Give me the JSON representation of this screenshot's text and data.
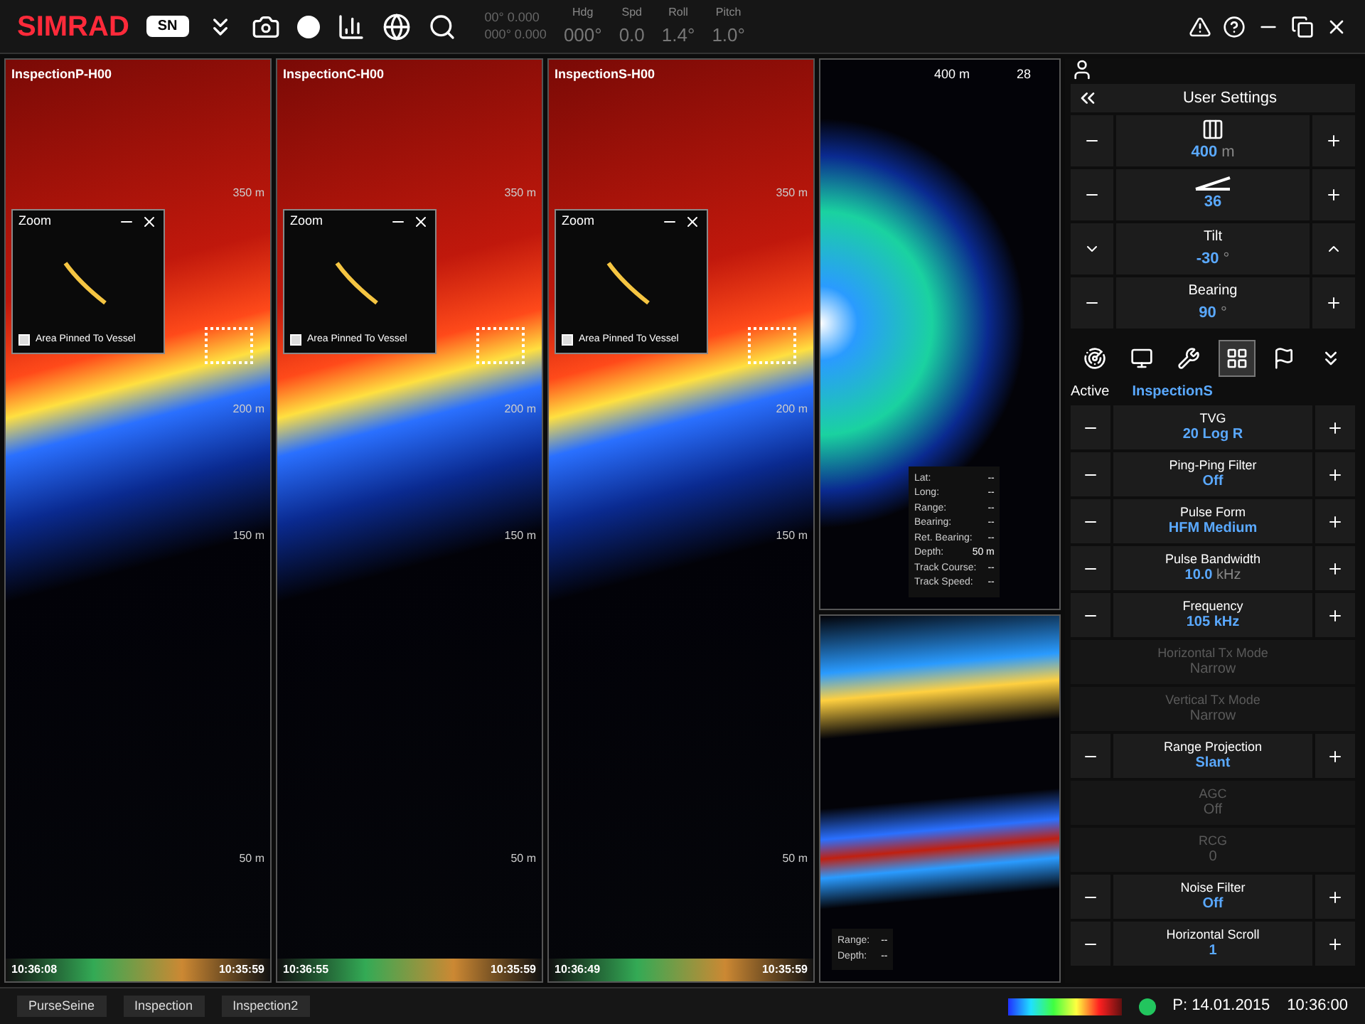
{
  "toolbar": {
    "logo": "SIMRAD",
    "model": "SN",
    "position": [
      "00° 0.000",
      "000° 0.000"
    ],
    "readouts": [
      {
        "label": "Hdg",
        "value": "000",
        "unit": "°"
      },
      {
        "label": "Spd",
        "value": "0.0"
      },
      {
        "label": "Roll",
        "value": "1.4",
        "unit": "°"
      },
      {
        "label": "Pitch",
        "value": "1.0",
        "unit": "°"
      }
    ]
  },
  "echograms": [
    {
      "title": "InspectionP-H00",
      "depth_labels": [
        "350 m",
        "200 m",
        "150 m",
        "50 m"
      ],
      "zoom": {
        "title": "Zoom",
        "pinned_label": "Area Pinned To Vessel",
        "checked": false
      },
      "time_left": "10:36:08",
      "time_right": "10:35:59"
    },
    {
      "title": "InspectionC-H00",
      "depth_labels": [
        "350 m",
        "200 m",
        "150 m",
        "50 m"
      ],
      "zoom": {
        "title": "Zoom",
        "pinned_label": "Area Pinned To Vessel",
        "checked": false
      },
      "time_left": "10:36:55",
      "time_right": "10:35:59"
    },
    {
      "title": "InspectionS-H00",
      "depth_labels": [
        "350 m",
        "200 m",
        "150 m",
        "50 m"
      ],
      "zoom": {
        "title": "Zoom",
        "pinned_label": "Area Pinned To Vessel",
        "checked": false
      },
      "time_left": "10:36:49",
      "time_right": "10:35:59"
    }
  ],
  "sonar": {
    "range": "400 m",
    "bearing_mark": "28",
    "info": [
      {
        "label": "Lat:",
        "value": "--"
      },
      {
        "label": "Long:",
        "value": "--"
      },
      {
        "label": "Range:",
        "value": "--"
      },
      {
        "label": "Bearing:",
        "value": "--"
      },
      {
        "label": "Ret. Bearing:",
        "value": "--"
      },
      {
        "label": "Depth:",
        "value": "50 m"
      },
      {
        "label": "Track Course:",
        "value": "--"
      },
      {
        "label": "Track Speed:",
        "value": "--"
      }
    ]
  },
  "side_view": {
    "info": [
      {
        "label": "Range:",
        "value": "--"
      },
      {
        "label": "Depth:",
        "value": "--"
      }
    ]
  },
  "settings": {
    "title": "User Settings",
    "top_controls": [
      {
        "kind": "range",
        "value": "400",
        "unit": "m"
      },
      {
        "kind": "spread",
        "value": "36"
      },
      {
        "kind": "tilt",
        "label": "Tilt",
        "value": "-30",
        "unit": "°"
      },
      {
        "kind": "bearing",
        "label": "Bearing",
        "value": "90",
        "unit": "°"
      }
    ],
    "tabs": [
      {
        "kind": "sonar",
        "selected": false
      },
      {
        "kind": "display",
        "selected": false
      },
      {
        "kind": "tools",
        "selected": false
      },
      {
        "kind": "layout",
        "selected": true
      },
      {
        "kind": "marker",
        "selected": false
      },
      {
        "kind": "more",
        "selected": false
      }
    ],
    "active_label": "Active",
    "active_value": "InspectionS",
    "params": [
      {
        "label": "TVG",
        "value": "20 Log R",
        "disabled": false
      },
      {
        "label": "Ping-Ping Filter",
        "value": "Off",
        "disabled": false
      },
      {
        "label": "Pulse Form",
        "value": "HFM Medium",
        "disabled": false
      },
      {
        "label": "Pulse Bandwidth",
        "value": "10.0",
        "unit": "kHz",
        "disabled": false
      },
      {
        "label": "Frequency",
        "value": "105 kHz",
        "disabled": false
      },
      {
        "label": "Horizontal Tx Mode",
        "value": "Narrow",
        "disabled": true
      },
      {
        "label": "Vertical Tx Mode",
        "value": "Narrow",
        "disabled": true
      },
      {
        "label": "Range Projection",
        "value": "Slant",
        "disabled": false
      },
      {
        "label": "AGC",
        "value": "Off",
        "disabled": true
      },
      {
        "label": "RCG",
        "value": "0",
        "disabled": true
      },
      {
        "label": "Noise Filter",
        "value": "Off",
        "disabled": false
      },
      {
        "label": "Horizontal Scroll",
        "value": "1",
        "disabled": false
      }
    ]
  },
  "status_bar": {
    "modes": [
      "PurseSeine",
      "Inspection",
      "Inspection2"
    ],
    "date": "P: 14.01.2015",
    "time": "10:36:00"
  }
}
